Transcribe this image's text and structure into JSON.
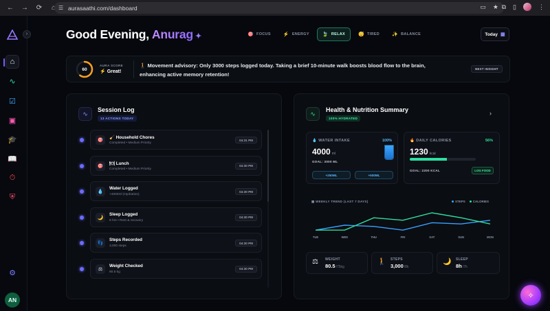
{
  "browser": {
    "url": "aurasaathi.com/dashboard"
  },
  "header": {
    "greeting": "Good Evening, ",
    "name": "Anurag",
    "modes": [
      {
        "label": "FOCUS",
        "icon": "🎯",
        "active": false
      },
      {
        "label": "ENERGY",
        "icon": "⚡",
        "active": false
      },
      {
        "label": "RELAX",
        "icon": "🍃",
        "active": true
      },
      {
        "label": "TIRED",
        "icon": "😴",
        "active": false
      },
      {
        "label": "BALANCE",
        "icon": "✨",
        "active": false
      }
    ],
    "date_button": "Today"
  },
  "aura": {
    "score": "60",
    "score_fraction": 0.6,
    "label": "AURA SCORE",
    "status": "Great!",
    "advisory": "Movement advisory: Only 3000 steps logged today. Taking a brief 10-minute walk boosts blood flow to the brain, enhancing active memory retention!",
    "next_button": "NEXT INSIGHT"
  },
  "session_log": {
    "title": "Session Log",
    "badge": "13 ACTIONS TODAY",
    "items": [
      {
        "icon": "🎯",
        "title": "🧹 Household Chores",
        "subtitle": "Completed • Medium Priority",
        "time": "04:31 PM"
      },
      {
        "icon": "🎯",
        "title": "🍽 Lunch",
        "subtitle": "Completed • Medium Priority",
        "time": "04:30 PM"
      },
      {
        "icon": "💧",
        "title": "Water Logged",
        "subtitle": "+4000ml (Hydration)",
        "time": "04:30 PM"
      },
      {
        "icon": "🌙",
        "title": "Sleep Logged",
        "subtitle": "8 hrs • Rest & recovery",
        "time": "04:30 PM"
      },
      {
        "icon": "👣",
        "title": "Steps Recorded",
        "subtitle": "3,000 steps",
        "time": "04:30 PM"
      },
      {
        "icon": "⚖",
        "title": "Weight Checked",
        "subtitle": "80.5 kg",
        "time": "04:30 PM"
      }
    ]
  },
  "health": {
    "title": "Health & Nutrition Summary",
    "badge": "100% HYDRATED",
    "water": {
      "label": "WATER INTAKE",
      "percent": "100%",
      "fill_fraction": 1.0,
      "value": "4000",
      "unit": "ml",
      "goal": "GOAL: 3000 ML",
      "add_small": "+250ML",
      "add_large": "+500ML"
    },
    "calories": {
      "label": "DAILY CALORIES",
      "percent": "56%",
      "fill_fraction": 0.56,
      "value": "1230",
      "unit": "kcal",
      "goal": "GOAL: 2200 KCAL",
      "log_button": "LOG FOOD"
    },
    "trend": {
      "title": "WEEKLY TREND (LAST 7 DAYS)",
      "legend_steps": "STEPS",
      "legend_calories": "CALORIES",
      "color_steps": "#3aa0ff",
      "color_calories": "#2ee0a0"
    },
    "stats": [
      {
        "icon": "⚖",
        "label": "WEIGHT",
        "value": "80.5",
        "unit": "/75kg"
      },
      {
        "icon": "🚶",
        "label": "STEPS",
        "value": "3,000",
        "unit": "/8k"
      },
      {
        "icon": "🌙",
        "label": "SLEEP",
        "value": "8h",
        "unit": "/7h"
      }
    ]
  },
  "chart_data": {
    "type": "line",
    "categories": [
      "TUE",
      "WED",
      "THU",
      "FRI",
      "SAT",
      "SUN",
      "MON"
    ],
    "series": [
      {
        "name": "STEPS",
        "values": [
          0.05,
          0.25,
          0.2,
          0.05,
          0.35,
          0.3,
          0.45
        ]
      },
      {
        "name": "CALORIES",
        "values": [
          0.05,
          0.05,
          0.55,
          0.45,
          0.75,
          0.55,
          0.3
        ]
      }
    ],
    "ylim": [
      0,
      1
    ],
    "grid": false,
    "legend": "top-right"
  },
  "sidebar": {
    "avatar": "AN"
  }
}
